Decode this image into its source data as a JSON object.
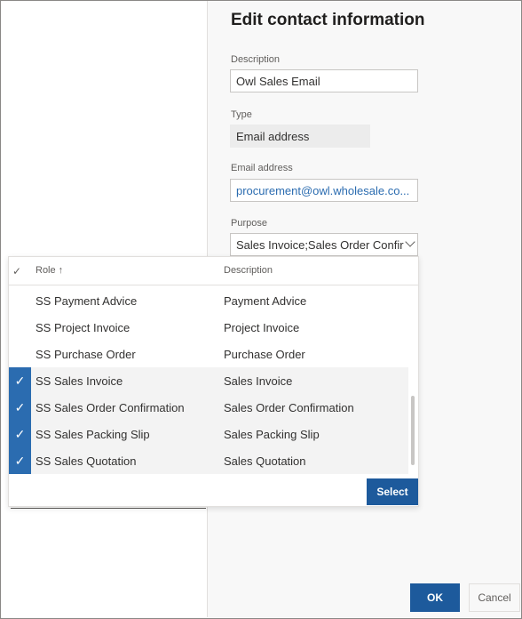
{
  "dialog": {
    "title": "Edit contact information"
  },
  "form": {
    "description_label": "Description",
    "description_value": "Owl Sales Email",
    "type_label": "Type",
    "type_value": "Email address",
    "email_label": "Email address",
    "email_value": "procurement@owl.wholesale.co...",
    "purpose_label": "Purpose",
    "purpose_value": "Sales Invoice;Sales Order Confir"
  },
  "dropdown": {
    "header_check": "✓",
    "header_role": "Role ↑",
    "header_description": "Description",
    "rows": [
      {
        "role": "SS Payment Advice",
        "description": "Payment Advice",
        "selected": false
      },
      {
        "role": "SS Project Invoice",
        "description": "Project Invoice",
        "selected": false
      },
      {
        "role": "SS Purchase Order",
        "description": "Purchase Order",
        "selected": false
      },
      {
        "role": "SS Sales Invoice",
        "description": "Sales Invoice",
        "selected": true
      },
      {
        "role": "SS Sales Order Confirmation",
        "description": "Sales Order Confirmation",
        "selected": true
      },
      {
        "role": "SS Sales Packing Slip",
        "description": "Sales Packing Slip",
        "selected": true
      },
      {
        "role": "SS Sales Quotation",
        "description": "Sales Quotation",
        "selected": true
      }
    ],
    "select_label": "Select"
  },
  "footer": {
    "ok_label": "OK",
    "cancel_label": "Cancel"
  },
  "colors": {
    "accent": "#1d5a9c",
    "checkbox": "#2b6cb0",
    "link": "#2b6cb0"
  }
}
